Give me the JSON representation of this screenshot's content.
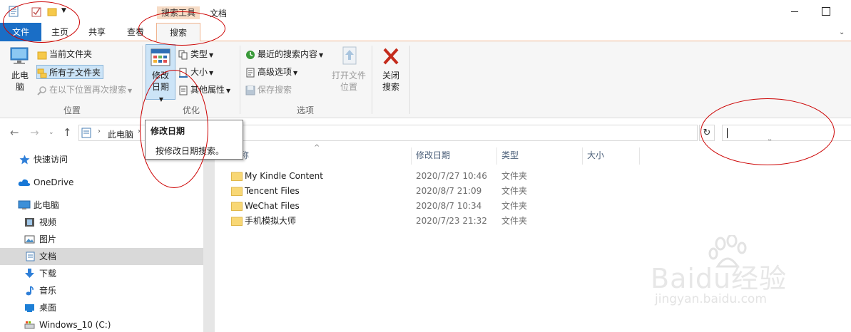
{
  "window": {
    "title": "文档",
    "contextual_tab_group": "搜索工具"
  },
  "tabs": [
    {
      "label": "文件"
    },
    {
      "label": "主页"
    },
    {
      "label": "共享"
    },
    {
      "label": "查看"
    },
    {
      "label": "搜索",
      "selected": true
    }
  ],
  "ribbon": {
    "location": {
      "label": "位置",
      "this_pc": "此电脑",
      "current_folder": "当前文件夹",
      "all_subfolders": "所有子文件夹",
      "search_again": "在以下位置再次搜索"
    },
    "refine": {
      "label": "优化",
      "date_modified": "修改日期",
      "kind": "类型",
      "size": "大小",
      "other_props": "其他属性"
    },
    "options": {
      "label": "选项",
      "recent_searches": "最近的搜索内容",
      "advanced": "高级选项",
      "save_search": "保存搜索",
      "open_location": "打开文件位置"
    },
    "close": {
      "close_search": "关闭搜索"
    }
  },
  "address": {
    "crumb": "此电脑",
    "search_value": ""
  },
  "tooltip": {
    "title": "修改日期",
    "text": "按修改日期搜索。"
  },
  "navpane": {
    "items": [
      {
        "label": "快速访问",
        "icon": "star-icon"
      },
      {
        "label": "OneDrive",
        "icon": "cloud-icon"
      },
      {
        "label": "此电脑",
        "icon": "computer-icon"
      },
      {
        "label": "视频",
        "icon": "video-icon"
      },
      {
        "label": "图片",
        "icon": "picture-icon"
      },
      {
        "label": "文档",
        "icon": "document-icon",
        "selected": true
      },
      {
        "label": "下载",
        "icon": "download-icon"
      },
      {
        "label": "音乐",
        "icon": "music-icon"
      },
      {
        "label": "桌面",
        "icon": "desktop-icon"
      },
      {
        "label": "Windows_10 (C:)",
        "icon": "drive-icon"
      }
    ]
  },
  "filelist": {
    "columns": [
      "称",
      "修改日期",
      "类型",
      "大小"
    ],
    "rows": [
      {
        "name": "My Kindle Content",
        "date": "2020/7/27 10:46",
        "type": "文件夹"
      },
      {
        "name": "Tencent Files",
        "date": "2020/8/7 21:09",
        "type": "文件夹"
      },
      {
        "name": "WeChat Files",
        "date": "2020/8/7 10:34",
        "type": "文件夹"
      },
      {
        "name": "手机模拟大师",
        "date": "2020/7/23 21:32",
        "type": "文件夹"
      }
    ]
  },
  "watermark": {
    "logo": "Baidu经验",
    "url": "jingyan.baidu.com"
  },
  "colors": {
    "accent": "#1a6ec6",
    "contextual_tab": "#f7dcc6",
    "selection": "#cce4f7",
    "annotation": "#cc0000"
  }
}
